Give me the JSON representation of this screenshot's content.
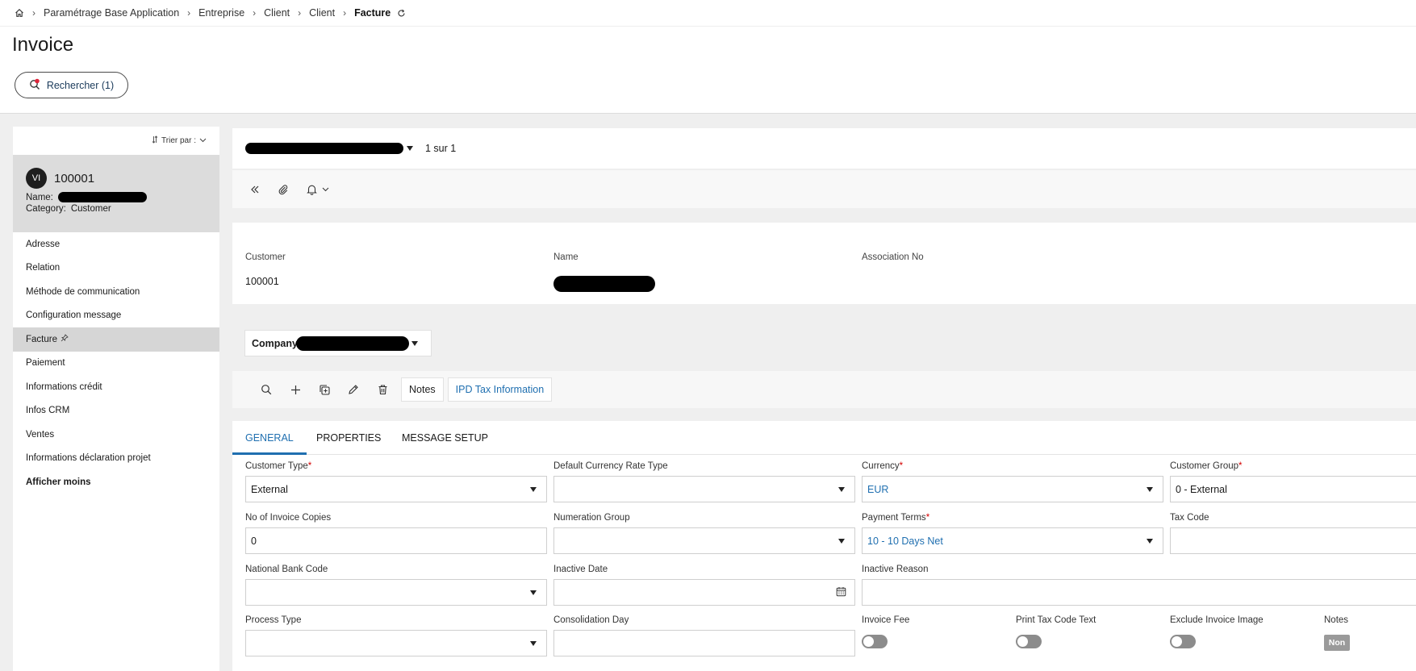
{
  "breadcrumb": {
    "items": [
      "Paramétrage Base Application",
      "Entreprise",
      "Client",
      "Client"
    ],
    "current": "Facture"
  },
  "page": {
    "title": "Invoice"
  },
  "search": {
    "label": "Rechercher (1)"
  },
  "left": {
    "sort_label": "Trier par :",
    "record": {
      "avatar": "VI",
      "id": "100001",
      "name_label": "Name:",
      "category_label": "Category:",
      "category_value": "Customer"
    },
    "nav": [
      "Adresse",
      "Relation",
      "Méthode de communication",
      "Configuration message",
      "Facture",
      "Paiement",
      "Informations crédit",
      "Infos CRM",
      "Ventes",
      "Informations déclaration projet",
      "Afficher moins"
    ]
  },
  "header": {
    "counter": "1 sur 1"
  },
  "info": {
    "customer_label": "Customer",
    "customer_value": "100001",
    "name_label": "Name",
    "association_label": "Association No"
  },
  "company": {
    "label": "Company:"
  },
  "toolbar": {
    "notes": "Notes",
    "ipd": "IPD Tax Information"
  },
  "tabs": [
    "GENERAL",
    "PROPERTIES",
    "MESSAGE SETUP"
  ],
  "form": {
    "customer_type": {
      "label": "Customer Type",
      "value": "External"
    },
    "default_currency_rate_type": {
      "label": "Default Currency Rate Type",
      "value": ""
    },
    "currency": {
      "label": "Currency",
      "value": "EUR"
    },
    "customer_group": {
      "label": "Customer Group",
      "value": "0 - External"
    },
    "invoice_copies": {
      "label": "No of Invoice Copies",
      "value": "0"
    },
    "numeration_group": {
      "label": "Numeration Group",
      "value": ""
    },
    "payment_terms": {
      "label": "Payment Terms",
      "value": "10 - 10 Days Net"
    },
    "tax_code": {
      "label": "Tax Code",
      "value": ""
    },
    "national_bank_code": {
      "label": "National Bank Code",
      "value": ""
    },
    "inactive_date": {
      "label": "Inactive Date",
      "value": ""
    },
    "inactive_reason": {
      "label": "Inactive Reason",
      "value": ""
    },
    "process_type": {
      "label": "Process Type",
      "value": ""
    },
    "consolidation_day": {
      "label": "Consolidation Day",
      "value": ""
    },
    "invoice_fee": {
      "label": "Invoice Fee",
      "on": false
    },
    "print_tax_code_text": {
      "label": "Print Tax Code Text",
      "on": false
    },
    "exclude_invoice_image": {
      "label": "Exclude Invoice Image",
      "on": false
    },
    "notes": {
      "label": "Notes",
      "value": "Non"
    }
  },
  "colors": {
    "accent": "#1f6fb0",
    "required": "#d40000",
    "selected_nav": "#d6d6d6",
    "background": "#efefef"
  }
}
